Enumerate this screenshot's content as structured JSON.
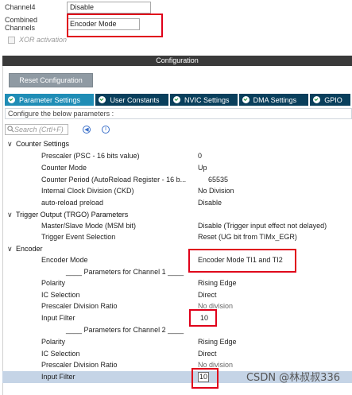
{
  "mode": {
    "channel4_label": "Channel4",
    "channel4_value": "Disable",
    "combined_label": "Combined Channels",
    "combined_value": "Encoder Mode",
    "xor_label": "XOR activation"
  },
  "config": {
    "header": "Configuration",
    "reset_label": "Reset Configuration",
    "tabs": [
      {
        "label": "Parameter Settings",
        "icon": "check-circle-icon",
        "active": true
      },
      {
        "label": "User Constants",
        "icon": "check-circle-icon",
        "active": false
      },
      {
        "label": "NVIC Settings",
        "icon": "check-circle-icon",
        "active": false
      },
      {
        "label": "DMA Settings",
        "icon": "check-circle-icon",
        "active": false
      },
      {
        "label": "GPIO",
        "icon": "check-circle-icon",
        "active": false
      }
    ],
    "hint": "Configure the below parameters :",
    "search_placeholder": "Search (Crtl+F)"
  },
  "tree": {
    "counter": {
      "label": "Counter Settings",
      "params": [
        {
          "name": "Prescaler (PSC - 16 bits value)",
          "value": "0"
        },
        {
          "name": "Counter Mode",
          "value": "Up"
        },
        {
          "name": "Counter Period (AutoReload Register - 16 b...",
          "value": "65535"
        },
        {
          "name": "Internal Clock Division (CKD)",
          "value": "No Division"
        },
        {
          "name": "auto-reload preload",
          "value": "Disable"
        }
      ]
    },
    "trgo": {
      "label": "Trigger Output (TRGO) Parameters",
      "params": [
        {
          "name": "Master/Slave Mode (MSM bit)",
          "value": "Disable (Trigger input effect not delayed)"
        },
        {
          "name": "Trigger Event Selection",
          "value": "Reset (UG bit from TIMx_EGR)"
        }
      ]
    },
    "encoder": {
      "label": "Encoder",
      "mode_name": "Encoder Mode",
      "mode_value": "Encoder Mode TI1 and TI2",
      "ch1_label": "____ Parameters for Channel 1 ____",
      "ch1": [
        {
          "name": "Polarity",
          "value": "Rising Edge"
        },
        {
          "name": "IC Selection",
          "value": "Direct"
        },
        {
          "name": "Prescaler Division Ratio",
          "value": "No division"
        },
        {
          "name": "Input Filter",
          "value": "10"
        }
      ],
      "ch2_label": "____ Parameters for Channel 2 ____",
      "ch2": [
        {
          "name": "Polarity",
          "value": "Rising Edge"
        },
        {
          "name": "IC Selection",
          "value": "Direct"
        },
        {
          "name": "Prescaler Division Ratio",
          "value": "No division"
        },
        {
          "name": "Input Filter",
          "value": "10"
        }
      ]
    }
  },
  "watermark": "CSDN @林叔叔336",
  "colors": {
    "accent_tab": "#1f8db6",
    "tab_bg": "#093f5c",
    "highlight": "#e0001a",
    "selected_row": "#c5d4e6"
  }
}
